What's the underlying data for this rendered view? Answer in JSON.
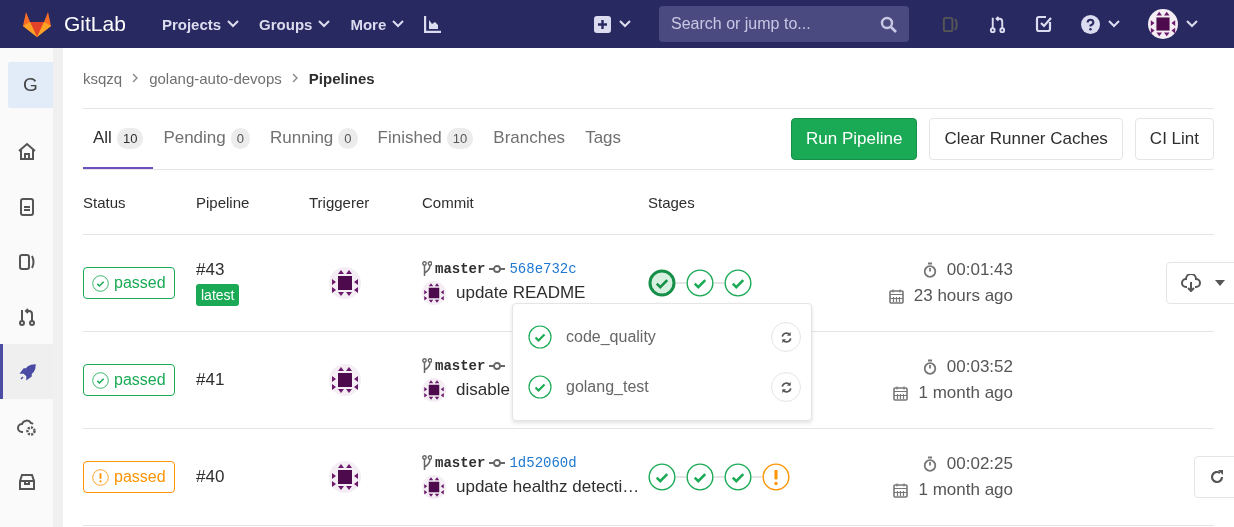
{
  "topbar": {
    "brand": "GitLab",
    "nav": [
      {
        "label": "Projects"
      },
      {
        "label": "Groups"
      },
      {
        "label": "More"
      }
    ],
    "search": {
      "placeholder": "Search or jump to..."
    }
  },
  "sidebar": {
    "project_initial": "G",
    "items": [
      {
        "selected": false
      },
      {
        "selected": false
      },
      {
        "selected": false
      },
      {
        "selected": false
      },
      {
        "selected": true
      },
      {
        "selected": false
      },
      {
        "selected": false
      }
    ]
  },
  "breadcrumb": [
    "ksqzq",
    "golang-auto-devops",
    "Pipelines"
  ],
  "tabs": [
    {
      "label": "All",
      "count": "10",
      "selected": true
    },
    {
      "label": "Pending",
      "count": "0",
      "selected": false
    },
    {
      "label": "Running",
      "count": "0",
      "selected": false
    },
    {
      "label": "Finished",
      "count": "10",
      "selected": false
    },
    {
      "label": "Branches",
      "selected": false
    },
    {
      "label": "Tags",
      "selected": false
    }
  ],
  "buttons": [
    {
      "label": "Run Pipeline",
      "kind": "primary"
    },
    {
      "label": "Clear Runner Caches",
      "kind": "default"
    },
    {
      "label": "CI Lint",
      "kind": "default"
    }
  ],
  "table": {
    "columns": [
      "Status",
      "Pipeline",
      "Triggerer",
      "Commit",
      "Stages"
    ],
    "rows": [
      {
        "status": {
          "label": "passed",
          "kind": "success"
        },
        "pipeline": "#43",
        "badge": "latest",
        "branch": "master",
        "commit": "568e732c",
        "message": "update README",
        "stages": [
          {
            "kind": "success",
            "selected": true
          },
          {
            "kind": "success",
            "selected": false
          },
          {
            "kind": "success",
            "selected": false
          }
        ],
        "duration": "00:01:43",
        "finished": "23 hours ago",
        "action": {
          "kind": "download"
        }
      },
      {
        "status": {
          "label": "passed",
          "kind": "success"
        },
        "pipeline": "#41",
        "branch": "master",
        "message": "disable",
        "duration": "00:03:52",
        "finished": "1 month ago"
      },
      {
        "status": {
          "label": "passed",
          "kind": "warning"
        },
        "pipeline": "#40",
        "branch": "master",
        "commit": "1d52060d",
        "message": "update healthz detecti…",
        "stages": [
          {
            "kind": "success",
            "selected": false
          },
          {
            "kind": "success",
            "selected": false
          },
          {
            "kind": "success",
            "selected": false
          },
          {
            "kind": "warning",
            "selected": false
          }
        ],
        "duration": "00:02:25",
        "finished": "1 month ago",
        "action": {
          "kind": "retry"
        }
      }
    ]
  },
  "stage_dropdown": {
    "jobs": [
      {
        "name": "code_quality",
        "kind": "success"
      },
      {
        "name": "golang_test",
        "kind": "success"
      }
    ]
  }
}
